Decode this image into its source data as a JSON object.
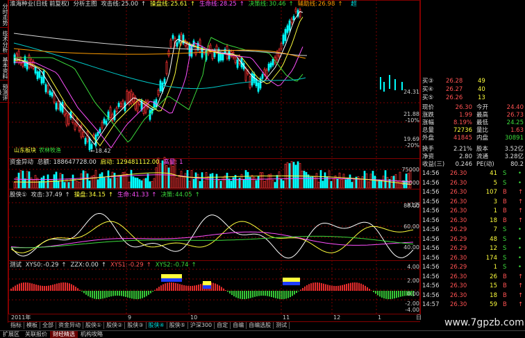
{
  "left_rail": [
    "分时走势",
    "技术分析",
    "基本资料",
    "预测评级"
  ],
  "main_header": {
    "title": "淮海种业(日线 前复权)",
    "indicator": "分析主图",
    "items": [
      {
        "label": "攻击线:",
        "value": "25.00",
        "color": "#ddd"
      },
      {
        "label": "操盘线:",
        "value": "25.61",
        "color": "#ffff3c"
      },
      {
        "label": "生命线:",
        "value": "28.25",
        "color": "#ff50ff"
      },
      {
        "label": "决策线:",
        "value": "30.46",
        "color": "#3cdc3c"
      },
      {
        "label": "辅助线:",
        "value": "26.98",
        "color": "#ff9c00"
      }
    ],
    "right_mark": "超"
  },
  "price_axis": [
    "24.31",
    "21.88",
    "-10%",
    "19.69",
    "-20%"
  ],
  "annotations": {
    "low_label": "←18.42",
    "board1": "山东板块",
    "board2": "农林牧渔"
  },
  "volume_header": {
    "title": "资金异动",
    "total_label": "总额:",
    "total": "188647728.00",
    "start_label": "启动:",
    "start": "129481112.00",
    "enter_label": "高量:",
    "enter": "1"
  },
  "volume_axis": [
    "75000",
    "50000",
    "25000",
    "X1万"
  ],
  "osc1_header": {
    "title": "股侠①",
    "items": [
      {
        "label": "攻击:",
        "value": "37.49",
        "color": "#ddd"
      },
      {
        "label": "操盘:",
        "value": "34.15",
        "color": "#ffff3c"
      },
      {
        "label": "生命:",
        "value": "41.33",
        "color": "#ff50ff"
      },
      {
        "label": "决策:",
        "value": "44.05",
        "color": "#3cdc3c"
      }
    ]
  },
  "osc1_axis": [
    "80.00",
    "60.00",
    "40.00"
  ],
  "osc2_header": {
    "title": "测试",
    "items": [
      {
        "label": "XYS0:",
        "value": "-0.29",
        "color": "#ddd"
      },
      {
        "label": "ZZX:",
        "value": "0.00",
        "color": "#ddd"
      },
      {
        "label": "XYS1:",
        "value": "-0.29",
        "color": "#ff5252"
      },
      {
        "label": "XYS2:",
        "value": "-0.74",
        "color": "#3cdc3c"
      }
    ]
  },
  "osc2_axis": [
    "4.00",
    "2.00",
    "0.00",
    "-2.00",
    "-4.00"
  ],
  "x_axis": [
    {
      "label": "2011年",
      "pos": 2
    },
    {
      "label": "9",
      "pos": 170
    },
    {
      "label": "10",
      "pos": 260
    },
    {
      "label": "11",
      "pos": 393
    },
    {
      "label": "12",
      "pos": 466
    },
    {
      "label": "1",
      "pos": 530
    },
    {
      "label": "日",
      "pos": 585
    }
  ],
  "order_book": [
    {
      "label": "买③",
      "price": "26.28",
      "vol": "49"
    },
    {
      "label": "买④",
      "price": "26.27",
      "vol": "40"
    },
    {
      "label": "买⑤",
      "price": "26.26",
      "vol": "13"
    }
  ],
  "quote": [
    {
      "l1": "现价",
      "v1": "26.30",
      "c1": "red",
      "l2": "今开",
      "v2": "24.40",
      "c2": "red"
    },
    {
      "l1": "涨跌",
      "v1": "1.99",
      "c1": "red",
      "l2": "最高",
      "v2": "26.73",
      "c2": "red"
    },
    {
      "l1": "涨幅",
      "v1": "8.19%",
      "c1": "red",
      "l2": "最低",
      "v2": "24.25",
      "c2": "green"
    },
    {
      "l1": "总量",
      "v1": "72736",
      "c1": "yellow",
      "l2": "量比",
      "v2": "1.63",
      "c2": "red"
    },
    {
      "l1": "外盘",
      "v1": "41845",
      "c1": "red",
      "l2": "内盘",
      "v2": "30891",
      "c2": "green"
    }
  ],
  "fundamentals": [
    {
      "l1": "换手",
      "v1": "2.21%",
      "l2": "股本",
      "v2": "3.52亿"
    },
    {
      "l1": "净资",
      "v1": "2.80",
      "l2": "流通",
      "v2": "3.28亿"
    },
    {
      "l1": "收益(三)",
      "v1": "0.246",
      "l2": "PE(动)",
      "v2": "80.2"
    }
  ],
  "ticks": [
    {
      "time": "14:56",
      "price": "26.30",
      "vol": "41",
      "side": "S"
    },
    {
      "time": "14:56",
      "price": "26.30",
      "vol": "5",
      "side": "S"
    },
    {
      "time": "14:56",
      "price": "26.30",
      "vol": "107",
      "side": "B"
    },
    {
      "time": "14:56",
      "price": "26.30",
      "vol": "3",
      "side": "B"
    },
    {
      "time": "14:56",
      "price": "26.30",
      "vol": "1",
      "side": "B"
    },
    {
      "time": "14:56",
      "price": "26.30",
      "vol": "18",
      "side": "B"
    },
    {
      "time": "14:56",
      "price": "26.29",
      "vol": "7",
      "side": "S"
    },
    {
      "time": "14:56",
      "price": "26.29",
      "vol": "48",
      "side": "S"
    },
    {
      "time": "14:56",
      "price": "26.29",
      "vol": "12",
      "side": "S"
    },
    {
      "time": "14:56",
      "price": "26.30",
      "vol": "174",
      "side": "S"
    },
    {
      "time": "14:56",
      "price": "26.29",
      "vol": "1",
      "side": "S"
    },
    {
      "time": "14:56",
      "price": "26.30",
      "vol": "26",
      "side": "B"
    },
    {
      "time": "14:56",
      "price": "26.30",
      "vol": "15",
      "side": "B"
    },
    {
      "time": "14:56",
      "price": "26.30",
      "vol": "18",
      "side": "B"
    },
    {
      "time": "14:57",
      "price": "26.30",
      "vol": "59",
      "side": "B"
    }
  ],
  "bottom_tabs": [
    "指标",
    "模板",
    "全部",
    "资金异动",
    "股侠①",
    "股侠②",
    "股侠③",
    "股侠④",
    "股侠⑤",
    "沪深300",
    "自定",
    "自编",
    "自编选股",
    "测试"
  ],
  "bottom_active": 7,
  "status_tabs": [
    "扩展区",
    "关联报价",
    "财经精选",
    "机构攻略"
  ],
  "status_active": 2,
  "watermark": "www.7gpzb.com",
  "colors": {
    "up": "#ff3232",
    "down": "#00ffff",
    "grid": "#800000"
  }
}
